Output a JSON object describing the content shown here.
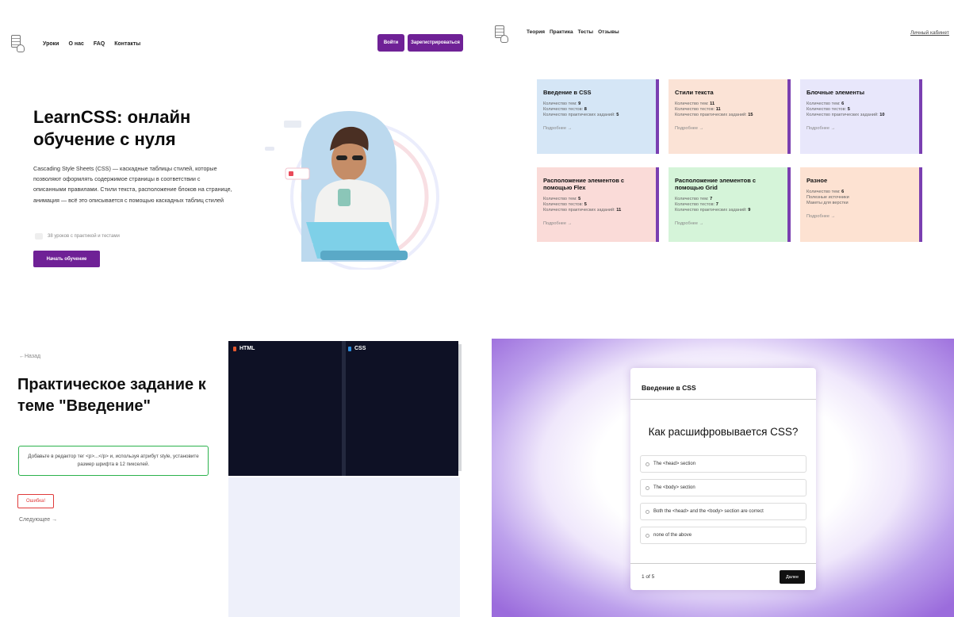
{
  "landing": {
    "nav": [
      "Уроки",
      "О нас",
      "FAQ",
      "Контакты"
    ],
    "login_label": "Войти",
    "register_label": "Зарегистрироваться",
    "title": "LearnCSS: онлайн обучение с нуля",
    "description": "Cascading Style Sheets (CSS) — каскадные таблицы стилей, которые позволяют оформлять содержимое страницы в соответствии с описанными правилами. Стили текста, расположение блоков на странице, анимация — всё это описывается с помощью каскадных таблиц стилей",
    "stat": "38 уроков с практикой и тестами",
    "start_label": "Начать обучение"
  },
  "courses": {
    "nav": [
      "Теория",
      "Практика",
      "Тесты",
      "Отзывы"
    ],
    "cabinet": "Личный кабинет",
    "more": "Подробнее →",
    "cards": [
      {
        "title": "Введение в CSS",
        "color": "#d5e6f6",
        "lines": [
          [
            "Количество тем: ",
            "9"
          ],
          [
            "Количество тестов: ",
            "8"
          ],
          [
            "Количество практических заданий: ",
            "5"
          ]
        ]
      },
      {
        "title": "Стили текста",
        "color": "#fbe3d6",
        "lines": [
          [
            "Количество тем: ",
            "11"
          ],
          [
            "Количество тестов: ",
            "11"
          ],
          [
            "Количество практических заданий: ",
            "15"
          ]
        ]
      },
      {
        "title": "Блочные элементы",
        "color": "#e8e7fb",
        "lines": [
          [
            "Количество тем: ",
            "6"
          ],
          [
            "Количество тестов: ",
            "5"
          ],
          [
            "Количество практических заданий: ",
            "10"
          ]
        ]
      },
      {
        "title": "Расположение элементов с помощью Flex",
        "color": "#fadbd8",
        "lines": [
          [
            "Количество тем: ",
            "5"
          ],
          [
            "Количество тестов: ",
            "5"
          ],
          [
            "Количество практических заданий: ",
            "11"
          ]
        ]
      },
      {
        "title": "Расположение элементов с помощью Grid",
        "color": "#d5f4d9",
        "lines": [
          [
            "Количество тем: ",
            "7"
          ],
          [
            "Количество тестов: ",
            "7"
          ],
          [
            "Количество практических заданий: ",
            "9"
          ]
        ]
      },
      {
        "title": "Разное",
        "color": "#fde2d2",
        "lines": [
          [
            "Количество тем: ",
            "6"
          ],
          [
            "Полезные источники",
            ""
          ],
          [
            "Макеты для верстки",
            ""
          ]
        ]
      }
    ]
  },
  "practice": {
    "back": "←Назад",
    "title": "Практическое задание к теме \"Введение\"",
    "task": "Добавьте в редактор тег <p>...</p> и, используя атрибут style, установите размер шрифта в 12 пикселей.",
    "error_label": "Ошибка!",
    "next": "Следующее →",
    "tab_html": "HTML",
    "tab_css": "CSS",
    "html_color": "#e4572e",
    "css_color": "#2f8fdf"
  },
  "quiz": {
    "header": "Введение в CSS",
    "question": "Как расшифровывается CSS?",
    "options": [
      "The <head> section",
      "The <body> section",
      "Both the <head> and the <body> section are correct",
      "none of the above"
    ],
    "counter": "1 of 5",
    "next_label": "Далее"
  }
}
